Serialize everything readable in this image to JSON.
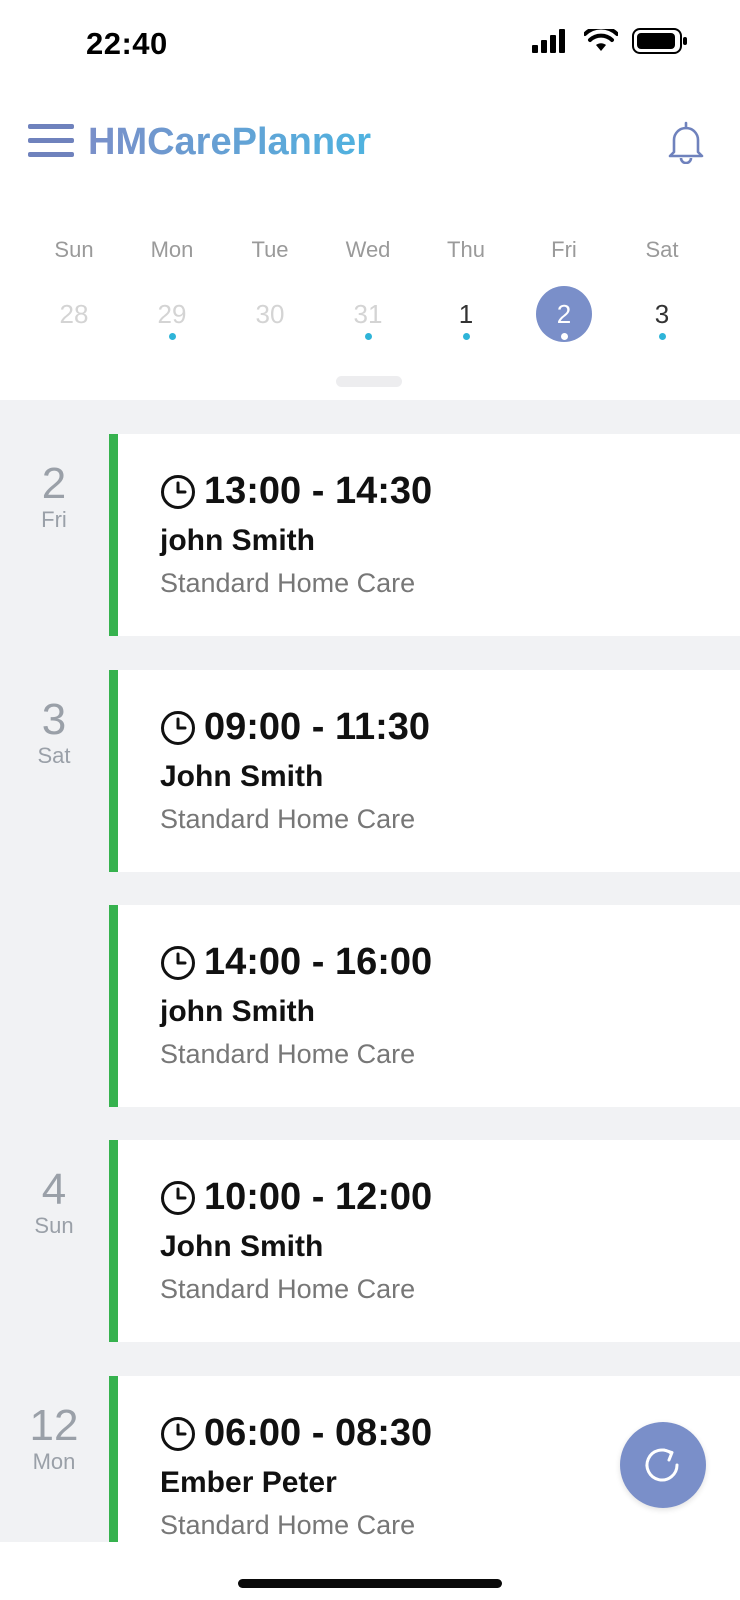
{
  "status_bar": {
    "time": "22:40",
    "icons": [
      "signal-icon",
      "wifi-icon",
      "battery-icon"
    ]
  },
  "header": {
    "app_name": "HMCarePlanner",
    "icons": [
      "hamburger-menu-icon",
      "bell-icon"
    ]
  },
  "colors": {
    "accent": "#7a8fc9",
    "visit_bar": "#36b24e",
    "event_dot": "#2eb4d8",
    "list_background": "#f1f2f4"
  },
  "week": {
    "days": [
      {
        "name": "Sun",
        "num": "28",
        "state": "past",
        "has_event": false
      },
      {
        "name": "Mon",
        "num": "29",
        "state": "past",
        "has_event": true
      },
      {
        "name": "Tue",
        "num": "30",
        "state": "past",
        "has_event": false
      },
      {
        "name": "Wed",
        "num": "31",
        "state": "past",
        "has_event": true
      },
      {
        "name": "Thu",
        "num": "1",
        "state": "current",
        "has_event": true
      },
      {
        "name": "Fri",
        "num": "2",
        "state": "selected",
        "has_event": true
      },
      {
        "name": "Sat",
        "num": "3",
        "state": "current",
        "has_event": true
      }
    ]
  },
  "visits": [
    {
      "date_num": "2",
      "date_dow": "Fri",
      "time": "13:00 - 14:30",
      "client": "john Smith",
      "type": "Standard Home Care"
    },
    {
      "date_num": "3",
      "date_dow": "Sat",
      "time": "09:00 - 11:30",
      "client": "John Smith",
      "type": "Standard Home Care"
    },
    {
      "date_num": "",
      "date_dow": "",
      "time": "14:00 - 16:00",
      "client": "john Smith",
      "type": "Standard Home Care"
    },
    {
      "date_num": "4",
      "date_dow": "Sun",
      "time": "10:00 - 12:00",
      "client": "John Smith",
      "type": "Standard Home Care"
    },
    {
      "date_num": "12",
      "date_dow": "Mon",
      "time": "06:00 - 08:30",
      "client": "Ember Peter",
      "type": "Standard Home Care"
    }
  ],
  "refresh_icon": "refresh-icon"
}
